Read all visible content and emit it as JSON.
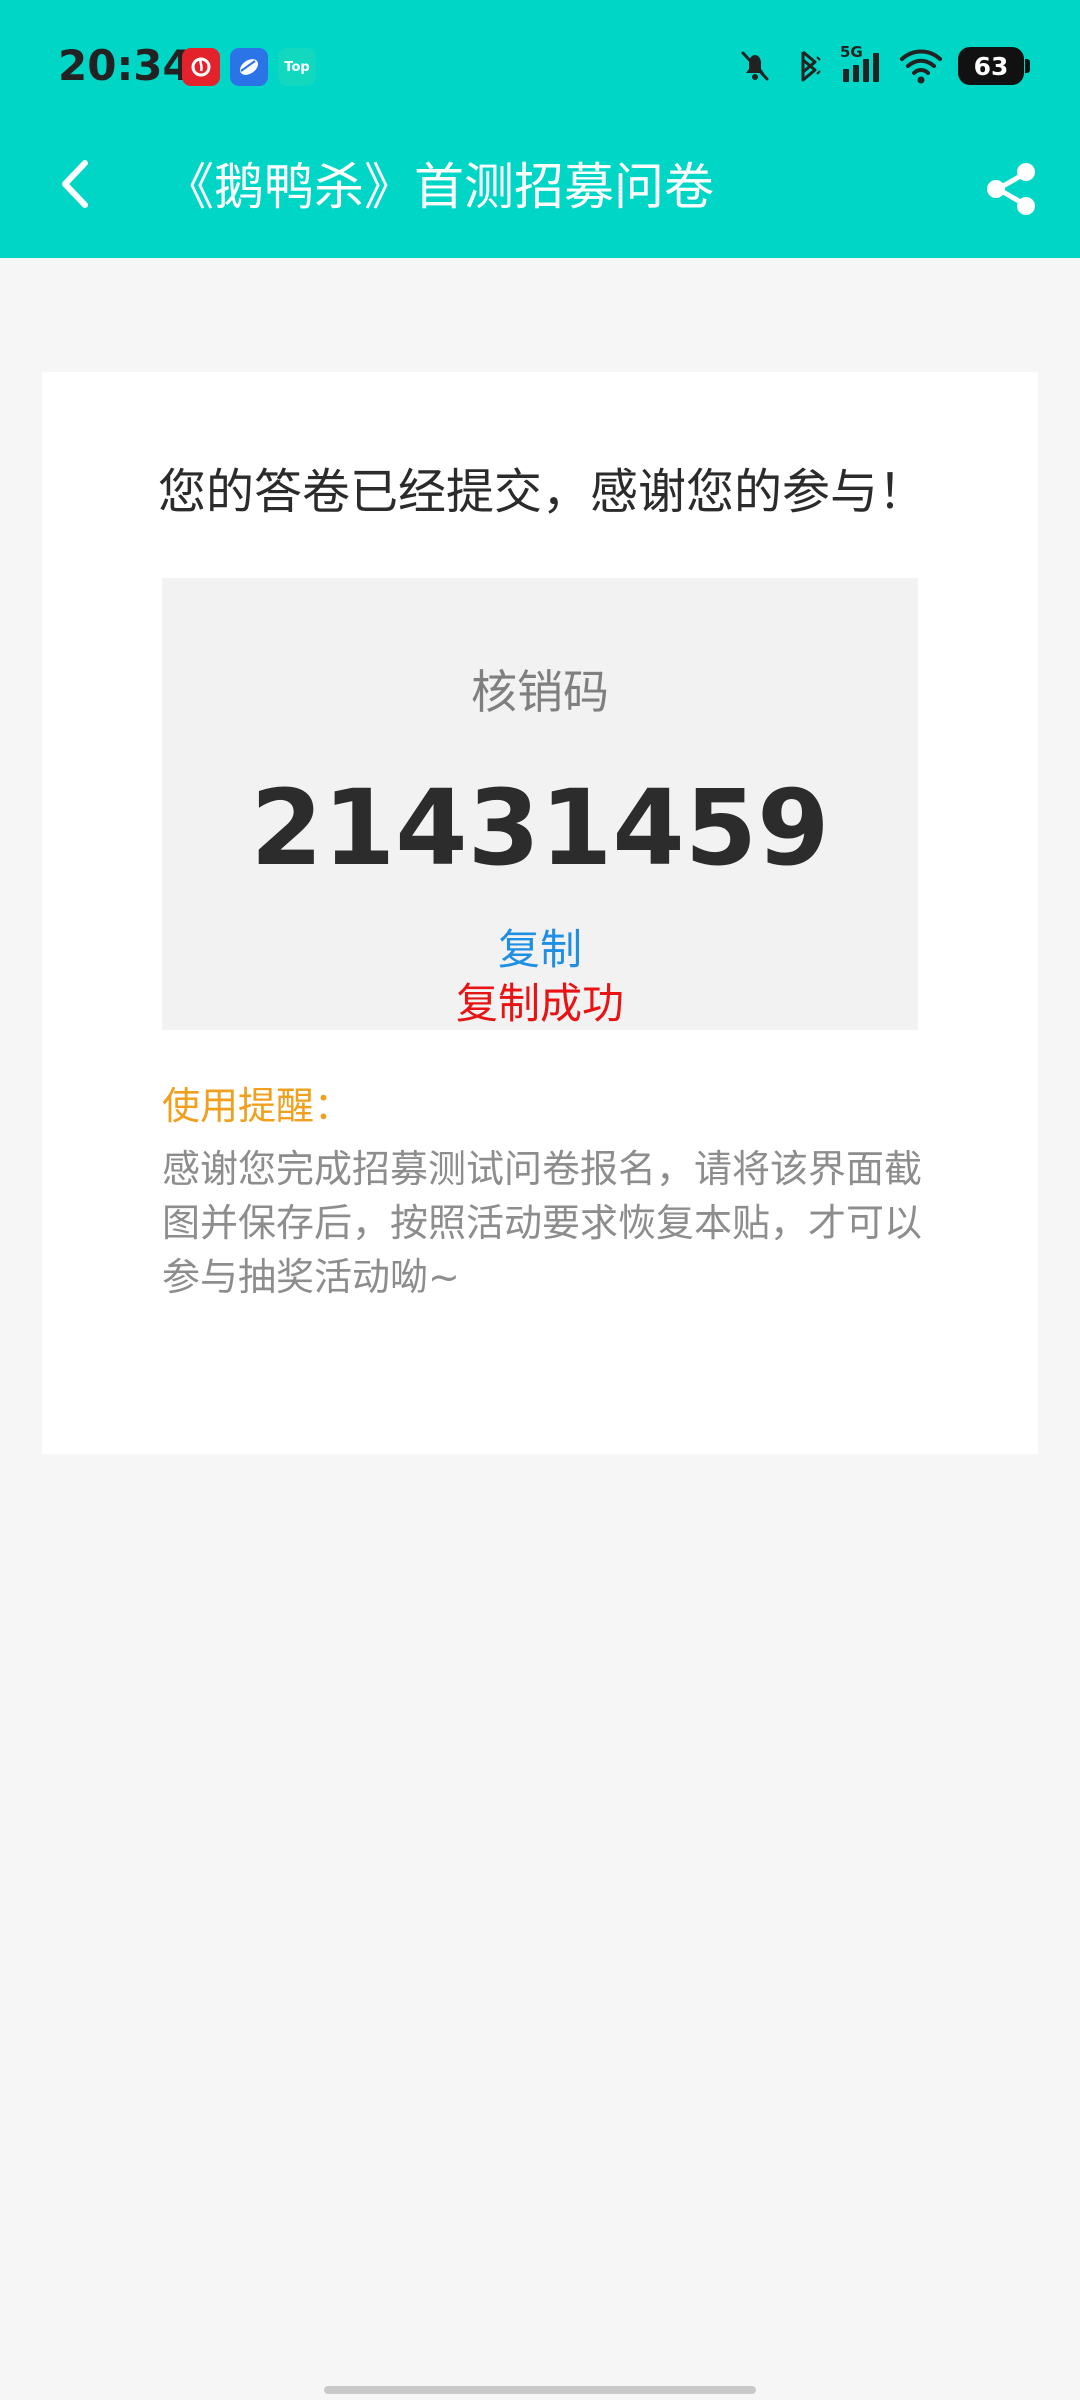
{
  "status_bar": {
    "time": "20:34",
    "app_icons": [
      "netease-cloud-music-icon",
      "cloud-app-icon",
      "top-app-icon"
    ],
    "top_icon_label": "Top",
    "network_label": "5G",
    "battery": "63"
  },
  "app_bar": {
    "title": "《鹅鸭杀》首测招募问卷",
    "back_icon": "back-arrow-icon",
    "share_icon": "share-icon"
  },
  "submission": {
    "thanks_message": "您的答卷已经提交，感谢您的参与！",
    "code_label": "核销码",
    "code_value": "21431459",
    "copy_label": "复制",
    "copy_success": "复制成功"
  },
  "tip": {
    "title": "使用提醒：",
    "body": "感谢您完成招募测试问卷报名，请将该界面截图并保存后，按照活动要求恢复本贴，才可以参与抽奖活动呦~"
  },
  "colors": {
    "header_bg": "#00d6c6",
    "page_bg": "#f6f6f6",
    "card_bg": "#ffffff",
    "code_box_bg": "#f2f2f2",
    "copy_link": "#1e8fe3",
    "copy_success": "#e81414",
    "tip_title": "#f0a01e",
    "tip_body": "#8d8d8d"
  }
}
